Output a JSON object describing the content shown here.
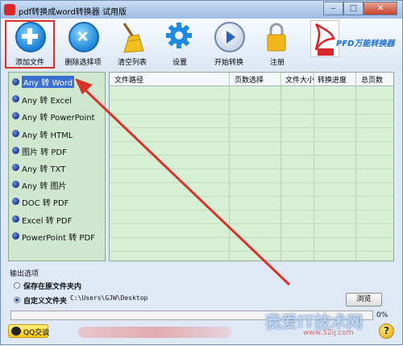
{
  "window": {
    "title": "pdf转换成word转换器 试用版",
    "controls": {
      "minimize": "‒",
      "maximize": "□",
      "close": "✕"
    }
  },
  "toolbar": {
    "add_file": "添加文件",
    "remove_selected": "删除选择项",
    "clear_list": "清空列表",
    "settings": "设置",
    "start_convert": "开始转换",
    "register": "注册",
    "brand_text": "PFD万能转换器",
    "brand_logo_text": "PDF"
  },
  "conversions": [
    "Any 转 Word",
    "Any 转 Excel",
    "Any 转 PowerPoint",
    "Any 转 HTML",
    "图片 转 PDF",
    "Any 转 TXT",
    "Any 转 图片",
    "DOC 转 PDF",
    "Excel 转 PDF",
    "PowerPoint 转 PDF"
  ],
  "selected_conversion": "Any 转 Word",
  "table": {
    "columns": [
      "文件路径",
      "页数选择",
      "文件大小",
      "转换进度",
      "总页数"
    ]
  },
  "output": {
    "section_title": "输出选项",
    "option_original": "保存在原文件夹内",
    "option_custom": "自定义文件夹",
    "custom_path": "C:\\Users\\GJW\\Desktop",
    "browse": "浏览",
    "progress_value": 0,
    "progress_text": "0%"
  },
  "footer": {
    "qq_button": "QQ交谈",
    "help": "?"
  },
  "watermark": {
    "text": "我爱IT技术网",
    "url": "www.52ij.com"
  },
  "colors": {
    "highlight": "#d9322a",
    "list_bg": "#cfe6cf",
    "table_bg": "#d7efd4",
    "selection": "#3a6fd0"
  }
}
